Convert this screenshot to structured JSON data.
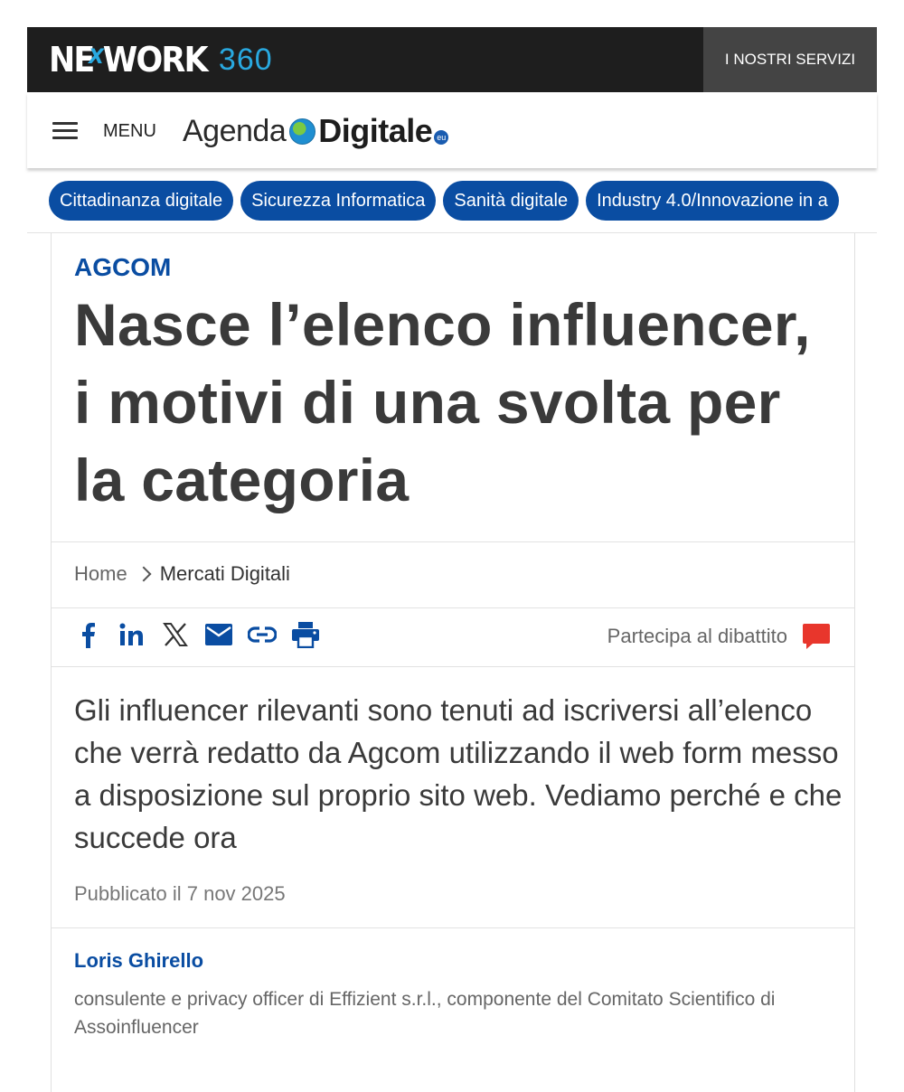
{
  "network_bar": {
    "logo_word": "NE  WORK",
    "logo_x": "X",
    "logo_number": "360",
    "services_label": "I NOSTRI SERVIZI",
    "colors": {
      "bar": "#1e1e1e",
      "accent": "#29a9e0",
      "services_bg": "#444444"
    }
  },
  "header": {
    "menu_label": "MENU",
    "brand_agenda": "Agenda",
    "brand_digitale": "Digitale",
    "brand_eu": "eu",
    "icons": [
      "hamburger-menu-icon",
      "globe-icon"
    ]
  },
  "categories": [
    "Cittadinanza digitale",
    "Sicurezza Informatica",
    "Sanità digitale",
    "Industry 4.0/Innovazione in a"
  ],
  "article": {
    "kicker": "AGCOM",
    "title": "Nasce l’elenco influencer, i motivi di una svolta per la categoria",
    "breadcrumb": {
      "home": "Home",
      "current": "Mercati Digitali"
    },
    "share_icons": [
      "facebook-icon",
      "linkedin-icon",
      "x-icon",
      "email-icon",
      "link-icon",
      "print-icon"
    ],
    "debate_label": "Partecipa al dibattito",
    "summary": "Gli influencer rilevanti sono tenuti ad iscriversi all’elenco che verrà redatto da Agcom utilizzando il web form messo a disposizione sul proprio sito web. Vediamo perché e che succede ora",
    "published": "Pubblicato il 7 nov 2025",
    "author_name": "Loris Ghirello",
    "author_role": "consulente e privacy officer di Effizient s.r.l., componente del Comitato Scientifico di Assoinfluencer"
  },
  "colors": {
    "brand_blue": "#0a4da2",
    "debate_red": "#e8362c"
  }
}
